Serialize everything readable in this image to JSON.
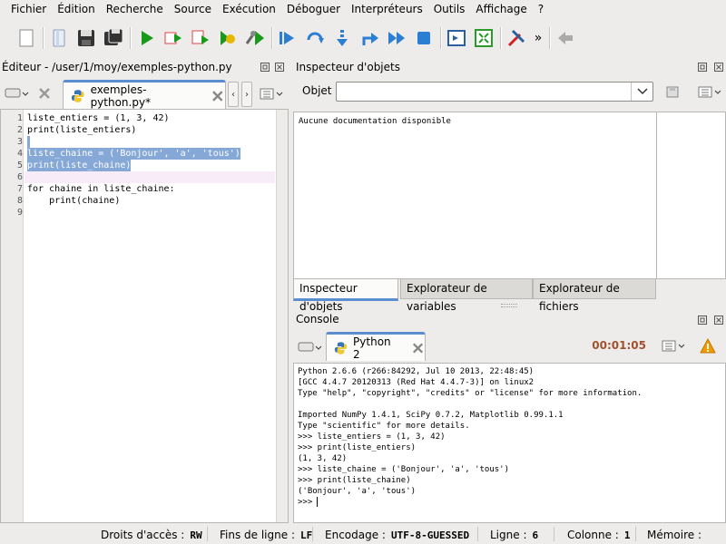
{
  "menubar": {
    "items": [
      {
        "label": "Fichier"
      },
      {
        "label": "Édition"
      },
      {
        "label": "Recherche"
      },
      {
        "label": "Source"
      },
      {
        "label": "Exécution"
      },
      {
        "label": "Déboguer"
      },
      {
        "label": "Interpréteurs"
      },
      {
        "label": "Outils"
      },
      {
        "label": "Affichage"
      },
      {
        "label": "?"
      }
    ]
  },
  "toolbar": {
    "icons": [
      "new-file-icon",
      "open-file-icon",
      "save-icon",
      "save-all-icon",
      "run-icon",
      "run-selection-icon",
      "run-cell-icon",
      "run-config-icon",
      "debug-icon",
      "step-icon",
      "step-into-icon",
      "step-return-icon",
      "continue-icon",
      "stop-icon",
      "maximize-pane-icon",
      "fullscreen-icon",
      "tools-icon",
      "more-icon",
      "back-icon"
    ],
    "overflow": "»"
  },
  "editor": {
    "title": "Éditeur - /user/1/moy/exemples-python.py",
    "tab_label": "exemples-python.py*",
    "line_numbers": [
      "1",
      "2",
      "3",
      "4",
      "5",
      "6",
      "7",
      "8",
      "9"
    ],
    "lines": [
      "liste_entiers = (1, 3, 42)",
      "print(liste_entiers)",
      "",
      "liste_chaine = ('Bonjour', 'a', 'tous')",
      "print(liste_chaine)",
      "",
      "for chaine in liste_chaine:",
      "    print(chaine)",
      ""
    ]
  },
  "inspector": {
    "title": "Inspecteur d'objets",
    "object_label": "Objet",
    "object_value": "",
    "doc_text": "Aucune documentation disponible",
    "tabs": [
      {
        "label": "Inspecteur d'objets",
        "active": true
      },
      {
        "label": "Explorateur de variables",
        "active": false
      },
      {
        "label": "Explorateur de fichiers",
        "active": false
      }
    ]
  },
  "console": {
    "title": "Console",
    "tab_label": "Python 2",
    "timer": "00:01:05",
    "lines": [
      "Python 2.6.6 (r266:84292, Jul 10 2013, 22:48:45)",
      "[GCC 4.4.7 20120313 (Red Hat 4.4.7-3)] on linux2",
      "Type \"help\", \"copyright\", \"credits\" or \"license\" for more information.",
      "",
      "Imported NumPy 1.4.1, SciPy 0.7.2, Matplotlib 0.99.1.1",
      "Type \"scientific\" for more details.",
      ">>> liste_entiers = (1, 3, 42)",
      ">>> print(liste_entiers)",
      "(1, 3, 42)",
      ">>> liste_chaine = ('Bonjour', 'a', 'tous')",
      ">>> print(liste_chaine)",
      "('Bonjour', 'a', 'tous')",
      ">>> "
    ]
  },
  "statusbar": {
    "access_label": "Droits d'accès :",
    "access_value": "RW",
    "eol_label": "Fins de ligne :",
    "eol_value": "LF",
    "encoding_label": "Encodage :",
    "encoding_value": "UTF-8-GUESSED",
    "line_label": "Ligne :",
    "line_value": "6",
    "column_label": "Colonne :",
    "column_value": "1",
    "memory_label": "Mémoire :"
  },
  "colors": {
    "selection": "#86a8d7",
    "keyword": "#0000c8",
    "tab_accent": "#5b8ed1",
    "timer": "#a0522d"
  }
}
